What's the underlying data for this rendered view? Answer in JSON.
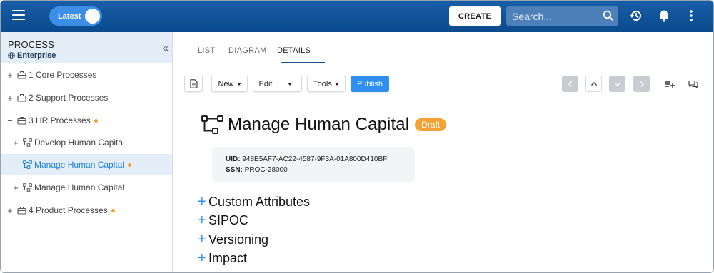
{
  "topbar": {
    "toggle_label": "Latest",
    "create_label": "CREATE",
    "search_placeholder": "Search..."
  },
  "sidebar": {
    "title": "PROCESS",
    "subtitle": "Enterprise",
    "collapse_glyph": "«",
    "items": [
      {
        "toggle": "+",
        "label": "1 Core Processes",
        "icon": "briefcase-icon",
        "dot": false
      },
      {
        "toggle": "+",
        "label": "2 Support Processes",
        "icon": "briefcase-icon",
        "dot": false
      },
      {
        "toggle": "−",
        "label": "3 HR Processes",
        "icon": "briefcase-icon",
        "dot": true
      },
      {
        "toggle": "+",
        "label": "Develop Human Capital",
        "icon": "process-flow-icon",
        "dot": false
      },
      {
        "toggle": "",
        "label": "Manage Human Capital",
        "icon": "process-flow-icon",
        "dot": true,
        "selected": true
      },
      {
        "toggle": "+",
        "label": "Manage Human Capital",
        "icon": "process-flow-icon",
        "dot": false
      },
      {
        "toggle": "+",
        "label": "4 Product Processes",
        "icon": "briefcase-icon",
        "dot": true
      }
    ]
  },
  "tabs": [
    "LIST",
    "DIAGRAM",
    "DETAILS"
  ],
  "active_tab": "DETAILS",
  "toolbar": {
    "new_label": "New",
    "edit_label": "Edit",
    "tools_label": "Tools",
    "publish_label": "Publish"
  },
  "detail": {
    "title": "Manage Human Capital",
    "status": "Draft",
    "uid_label": "UID:",
    "uid_value": "948E5AF7-AC22-4587-9F3A-01A800D410BF",
    "ssn_label": "SSN:",
    "ssn_value": "PROC-28000"
  },
  "sections": [
    "Custom Attributes",
    "SIPOC",
    "Versioning",
    "Impact"
  ],
  "colors": {
    "topbar": "#0b4a8c",
    "accent": "#2e8ff0",
    "draft_badge": "#f4a235",
    "status_dot": "#f0a030",
    "selected_bg": "#e3eef9"
  }
}
